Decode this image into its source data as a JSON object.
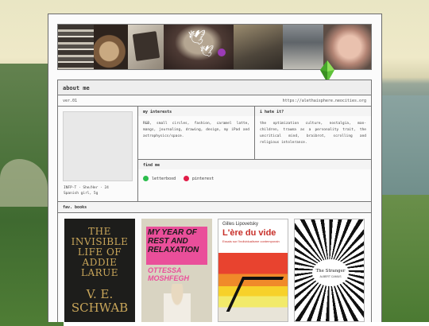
{
  "about": {
    "heading": "about me",
    "version": "ver.01",
    "url": "https://alethaisphere.neocities.org",
    "bio": "INFP-T · She/Her · 24\nSpanish girl, 5g"
  },
  "interests": {
    "heading": "my interests",
    "text": "R&B, small circles, fashion, caramel latte, mangs, journaling, drawing, design, my iPad and astrophysics/space."
  },
  "hates": {
    "heading": "i hate it?",
    "text": "the optimization culture, nostalgia, man-children, trauma as a personality trait, the uncritical mind, braibrot, scrolling and religious intolerance."
  },
  "find_me": {
    "heading": "find me",
    "links": [
      {
        "label": "letterboxd",
        "icon": "letterboxd-icon",
        "color": "#2bbd4c"
      },
      {
        "label": "pinterest",
        "icon": "pinterest-icon",
        "color": "#e11d48"
      }
    ]
  },
  "favs": {
    "heading": "fav. books",
    "books": [
      {
        "title": "THE INVISIBLE LIFE OF ADDIE LARUE",
        "author": "V. E. SCHWAB"
      },
      {
        "title": "MY YEAR OF REST AND RELAXATION",
        "author": "OTTESSA MOSHFEGH"
      },
      {
        "author": "Gilles Lipovetsky",
        "title": "L'ère du vide",
        "subtitle": "Essais sur l'individualisme contemporain"
      },
      {
        "title": "The Stranger",
        "author": "ALBERT CAMUS"
      }
    ]
  }
}
